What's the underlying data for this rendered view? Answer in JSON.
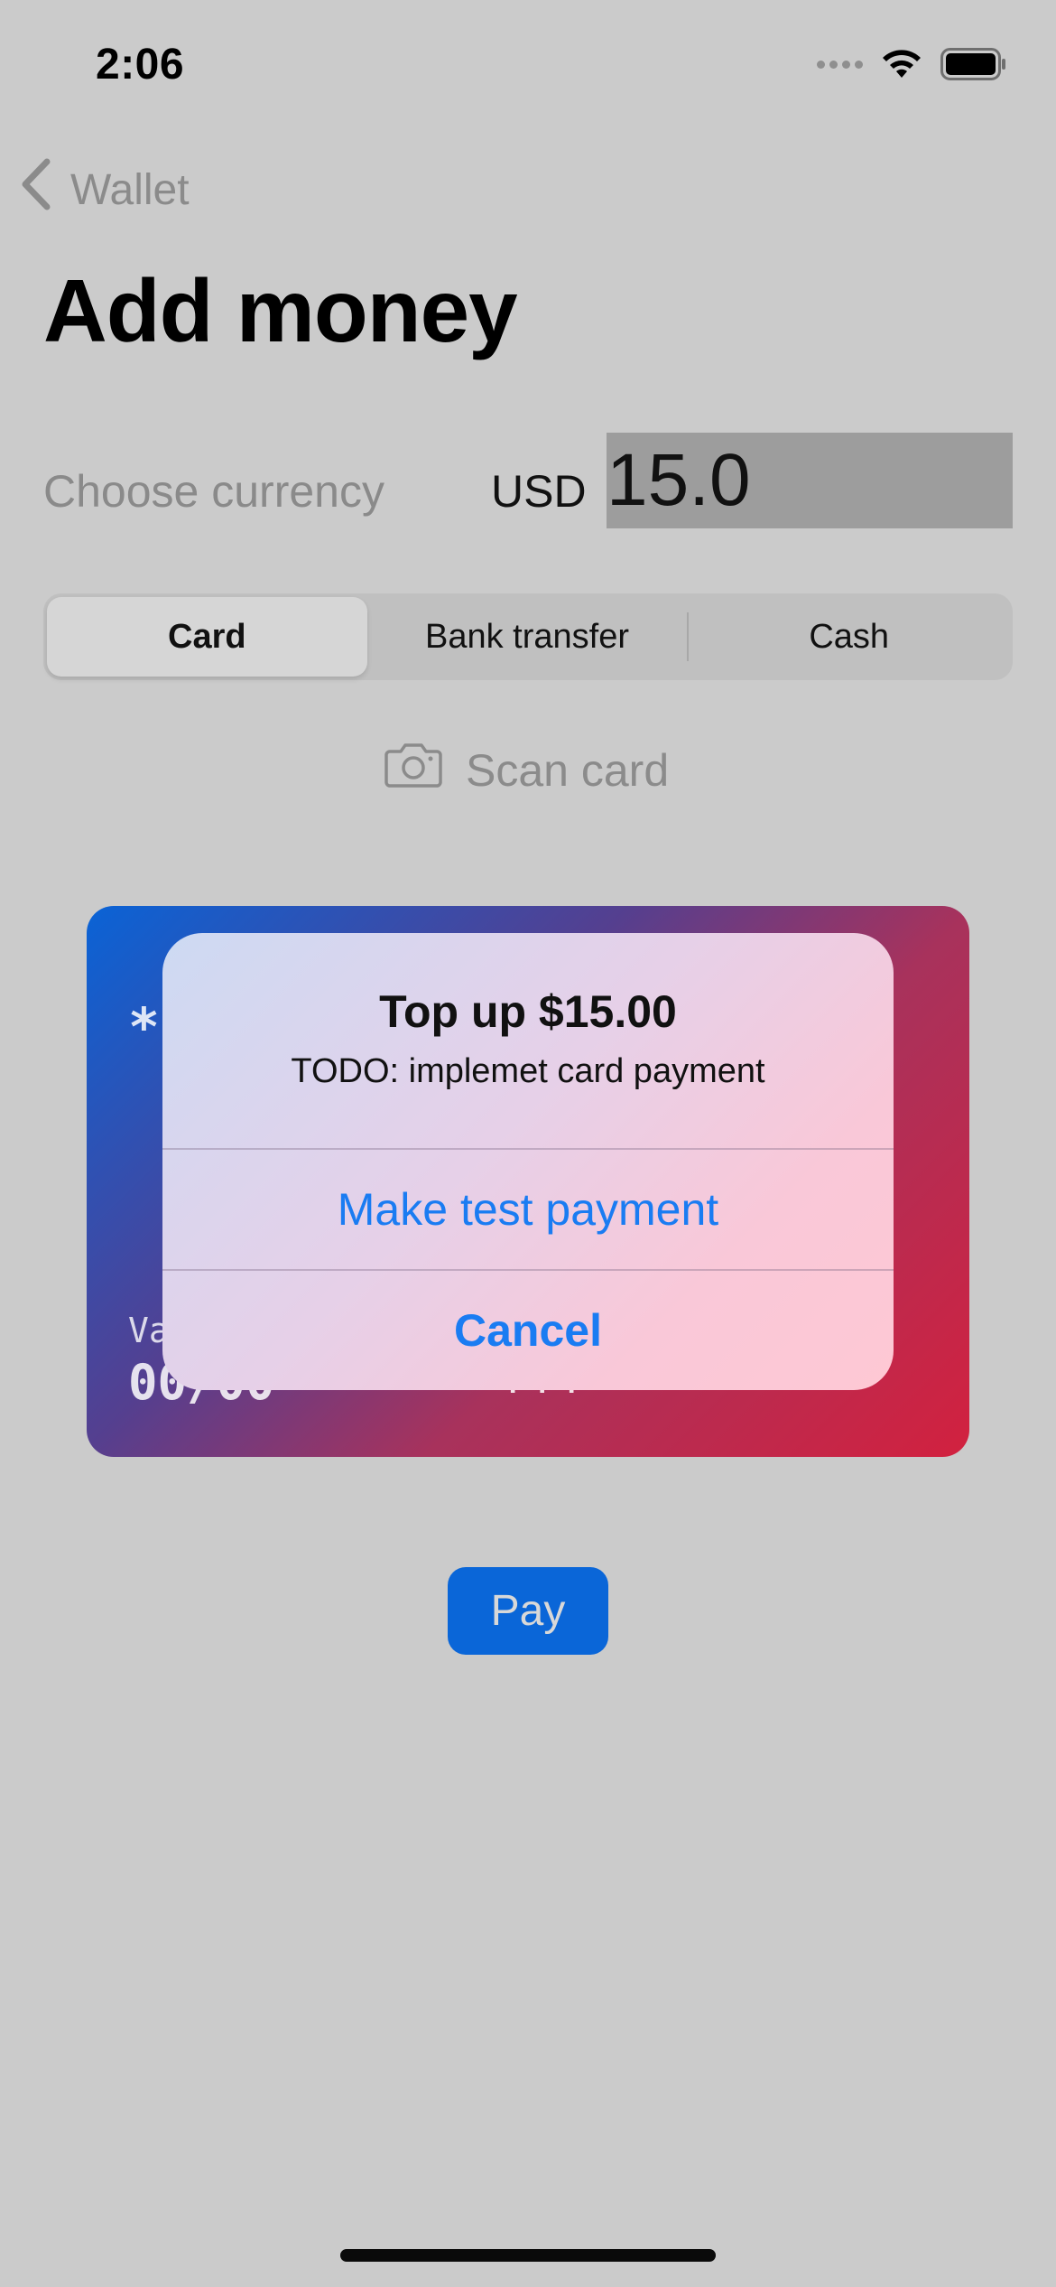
{
  "status_bar": {
    "time": "2:06",
    "icons": [
      "signal-dots",
      "wifi-icon",
      "battery-icon"
    ]
  },
  "nav": {
    "back_label": "Wallet",
    "title": "Add money"
  },
  "currency": {
    "label": "Choose currency",
    "code": "USD",
    "amount": "15.0"
  },
  "payment_method": {
    "segments": [
      "Card",
      "Bank transfer",
      "Cash"
    ],
    "selected": "Card"
  },
  "scan": {
    "label": "Scan card",
    "icon": "camera-icon"
  },
  "card_preview": {
    "number_masked": "*",
    "valid_label": "Va",
    "expiry": "00/00",
    "cvv": "***"
  },
  "alert": {
    "title": "Top up $15.00",
    "message": "TODO: implemet card payment",
    "actions": [
      "Make test payment",
      "Cancel"
    ]
  },
  "pay_button": {
    "label": "Pay"
  },
  "colors": {
    "background": "#cbcbcb",
    "accent": "#0a66d8",
    "alert_action": "#1a7cf2",
    "card_gradient_start": "#0a63d6",
    "card_gradient_end": "#d2213f"
  }
}
